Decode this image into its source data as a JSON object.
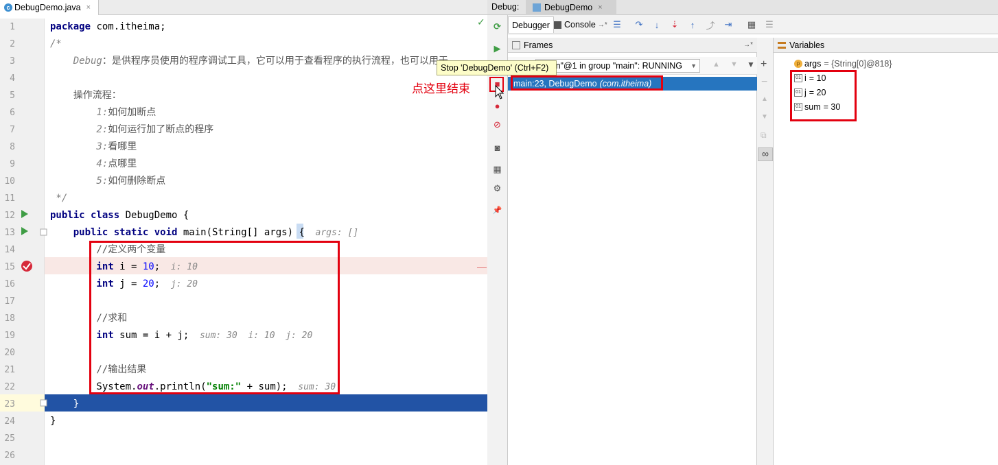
{
  "editor": {
    "tab": {
      "filename": "DebugDemo.java",
      "close": "×"
    },
    "line_numbers": [
      "1",
      "2",
      "3",
      "4",
      "5",
      "6",
      "7",
      "8",
      "9",
      "10",
      "11",
      "12",
      "13",
      "14",
      "15",
      "16",
      "17",
      "18",
      "19",
      "20",
      "21",
      "22",
      "23",
      "24",
      "25",
      "26"
    ],
    "code": {
      "l1_kw": "package",
      "l1_rest": " com.itheima;",
      "l2": "/*",
      "l3_a": "    Debug",
      "l3_b": "：是供程序员使用的程序调试工具，它可以用于查看程序的执行流程，也可以用于",
      "l5": "    操作流程：",
      "l6_n": "        1:",
      "l6_t": "如何加断点",
      "l7_n": "        2:",
      "l7_t": "如何运行加了断点的程序",
      "l8_n": "        3:",
      "l8_t": "看哪里",
      "l9_n": "        4:",
      "l9_t": "点哪里",
      "l10_n": "        5:",
      "l10_t": "如何删除断点",
      "l11": " */",
      "l12_kw": "public class",
      "l12_rest": " DebugDemo {",
      "l13_kw1": "    public static void",
      "l13_rest": " main(String[] args) {",
      "l13_hint": "  args: []",
      "l14": "        //定义两个变量",
      "l15_kw": "        int",
      "l15_a": " i = ",
      "l15_num": "10",
      "l15_b": ";",
      "l15_hint": "  i: 10",
      "l16_kw": "        int",
      "l16_a": " j = ",
      "l16_num": "20",
      "l16_b": ";",
      "l16_hint": "  j: 20",
      "l18": "        //求和",
      "l19_kw": "        int",
      "l19_a": " sum = i + j;",
      "l19_hint": "  sum: 30  i: 10  j: 20",
      "l21": "        //输出结果",
      "l22_a": "        System.",
      "l22_field": "out",
      "l22_b": ".println(",
      "l22_str": "\"sum:\"",
      "l22_c": " + sum);",
      "l22_hint": "  sum: 30",
      "l23": "    }",
      "l24": "}"
    },
    "checkmark": "✓"
  },
  "debug": {
    "header_label": "Debug:",
    "session_tab": "DebugDemo",
    "session_close": "×",
    "tabs": {
      "debugger": "Debugger",
      "console": "Console",
      "console_pin": "→*"
    },
    "frames": {
      "title": "Frames",
      "pin": "→*",
      "thread": "\"main\"@1 in group \"main\": RUNNING",
      "frame_label": "main:23, DebugDemo",
      "frame_pkg": "(com.itheima)"
    },
    "variables": {
      "title": "Variables",
      "items": [
        {
          "name": "args",
          "value": "= {String[0]@818}",
          "badge": "p"
        },
        {
          "name": "i",
          "value": "= 10",
          "badge": "01"
        },
        {
          "name": "j",
          "value": "= 20",
          "badge": "01"
        },
        {
          "name": "sum",
          "value": "= 30",
          "badge": "01"
        }
      ]
    },
    "tooltip": "Stop 'DebugDemo' (Ctrl+F2)",
    "annotation": "点这里结束"
  },
  "icons": {
    "rerun": "⟳",
    "resume": "▶",
    "stop": "■",
    "view_breakpoints": "●",
    "mute_breakpoints": "⊘",
    "camera": "◙",
    "layout": "▦",
    "settings": "⚙",
    "pin": "📌",
    "step_over": "↷",
    "step_into": "↓",
    "force_step_into": "⇣",
    "step_out": "↑",
    "drop_frame": "⤴",
    "run_to_cursor": "⇥",
    "evaluate": "▦",
    "trace": "☰",
    "add": "+",
    "remove": "−",
    "up": "▲",
    "down": "▼",
    "copy": "⧉",
    "infinity": "∞",
    "filter": "▼"
  },
  "colors": {
    "accent_red": "#e3000f",
    "selection_blue": "#2675bf",
    "exec_line": "#2253a5"
  }
}
